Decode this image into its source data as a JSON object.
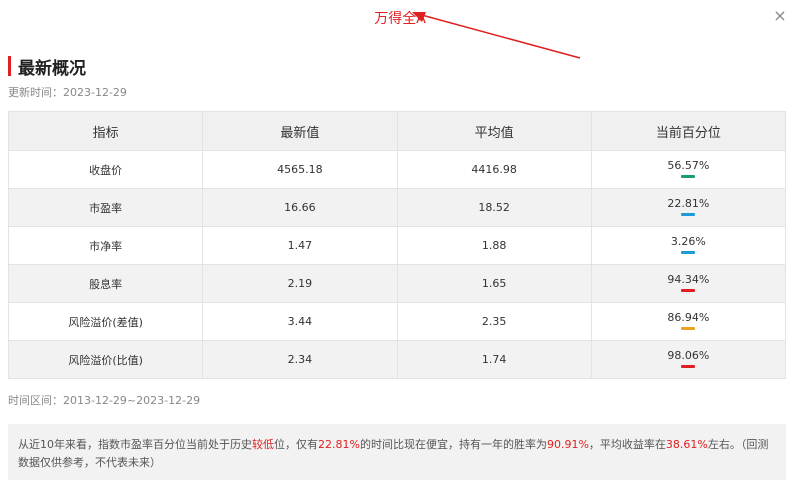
{
  "header": {
    "title": "万得全A",
    "close_glyph": "×"
  },
  "section": {
    "title": "最新概况",
    "updated_label": "更新时间：",
    "updated_value": "2023-12-29"
  },
  "table": {
    "headers": [
      "指标",
      "最新值",
      "平均值",
      "当前百分位"
    ],
    "rows": [
      {
        "name": "收盘价",
        "latest": "4565.18",
        "average": "4416.98",
        "percentile": "56.57%",
        "bar_color": "#1a9e6e"
      },
      {
        "name": "市盈率",
        "latest": "16.66",
        "average": "18.52",
        "percentile": "22.81%",
        "bar_color": "#1e9bd7"
      },
      {
        "name": "市净率",
        "latest": "1.47",
        "average": "1.88",
        "percentile": "3.26%",
        "bar_color": "#1e9bd7"
      },
      {
        "name": "股息率",
        "latest": "2.19",
        "average": "1.65",
        "percentile": "94.34%",
        "bar_color": "#e02020"
      },
      {
        "name": "风险溢价(差值)",
        "latest": "3.44",
        "average": "2.35",
        "percentile": "86.94%",
        "bar_color": "#f0a020"
      },
      {
        "name": "风险溢价(比值)",
        "latest": "2.34",
        "average": "1.74",
        "percentile": "98.06%",
        "bar_color": "#e02020"
      }
    ]
  },
  "range": {
    "label": "时间区间：",
    "value": "2013-12-29~2023-12-29"
  },
  "note": {
    "p1": "从近10年来看，指数市盈率百分位当前处于历史",
    "h1": "较低",
    "p2": "位，仅有",
    "h2": "22.81%",
    "p3": "的时间比现在便宜，持有一年的胜率为",
    "h3": "90.91%",
    "p4": "，平均收益率在",
    "h4": "38.61%",
    "p5": "左右。（回测数据仅供参考，不代表未来）"
  },
  "colors": {
    "accent": "#e02020"
  }
}
